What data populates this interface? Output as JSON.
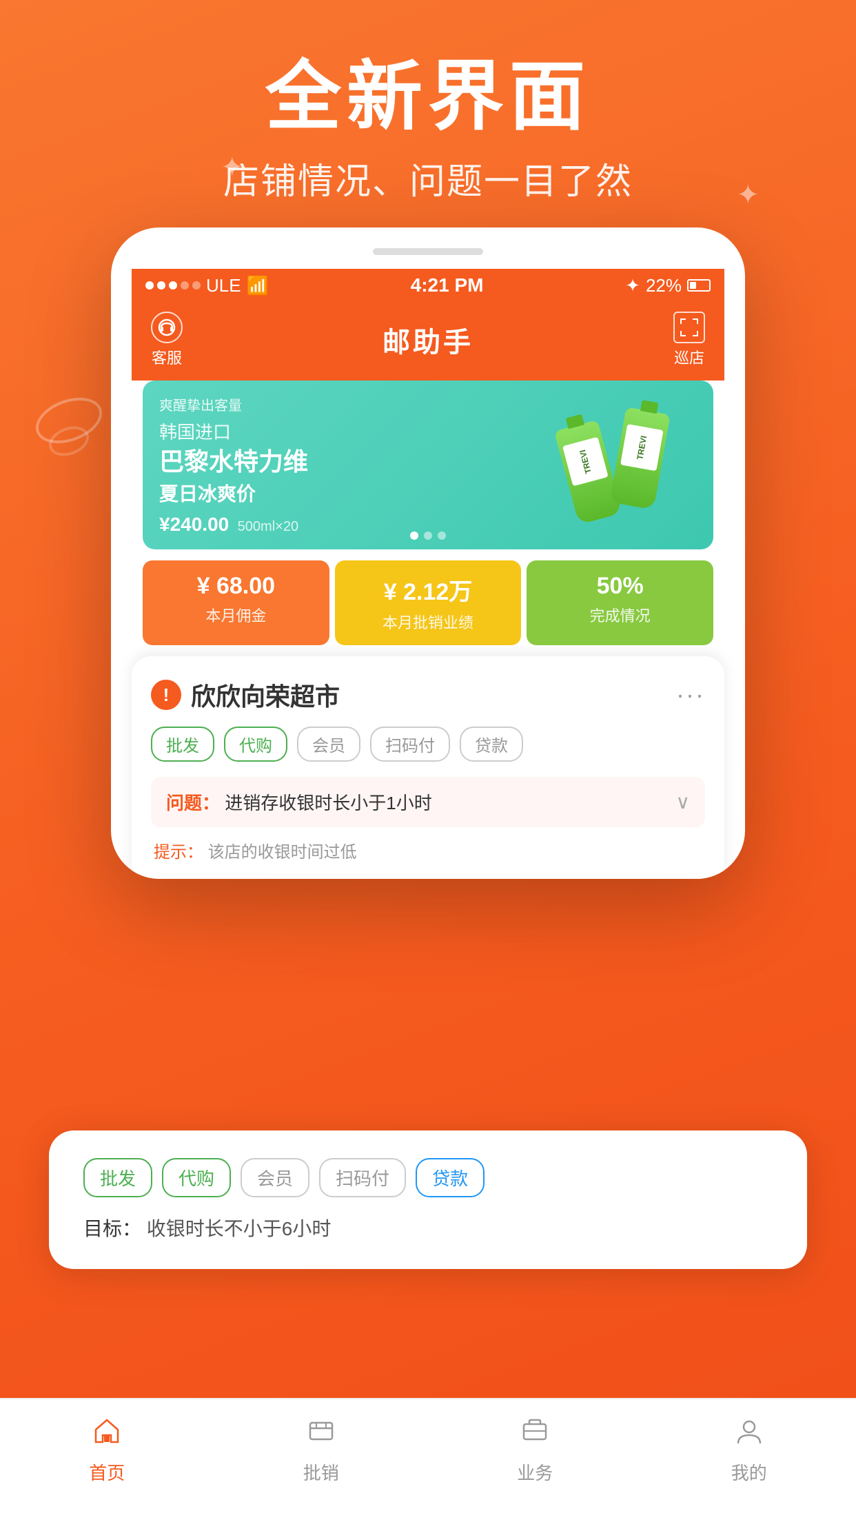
{
  "hero": {
    "title": "全新界面",
    "subtitle": "店铺情况、问题一目了然"
  },
  "phone": {
    "status_bar": {
      "carrier": "ULE",
      "wifi": "wifi",
      "time": "4:21 PM",
      "bluetooth": "bluetooth",
      "battery": "22%"
    },
    "header": {
      "left_label": "客服",
      "title": "邮助手",
      "right_label": "巡店"
    },
    "banner": {
      "tag": "爽醒挚出客量",
      "line1": "韩国进口",
      "title": "巴黎水特力维",
      "subtitle": "夏日冰爽价",
      "price": "¥240.00",
      "unit": "500ml×20"
    },
    "stats": [
      {
        "value": "¥ 68.00",
        "label": "本月佣金",
        "color": "orange"
      },
      {
        "value": "¥ 2.12万",
        "label": "本月批销业绩",
        "color": "yellow"
      },
      {
        "value": "50%",
        "label": "完成情况",
        "color": "green"
      }
    ]
  },
  "store_card": {
    "store_name": "欣欣向荣超市",
    "tags": [
      {
        "label": "批发",
        "type": "green"
      },
      {
        "label": "代购",
        "type": "green"
      },
      {
        "label": "会员",
        "type": "gray"
      },
      {
        "label": "扫码付",
        "type": "gray"
      },
      {
        "label": "贷款",
        "type": "gray"
      }
    ],
    "issue_label": "问题：",
    "issue_text": "进销存收银时长小于1小时",
    "hint_label": "提示：",
    "hint_text": "该店的收银时间过低"
  },
  "floating_card": {
    "tags": [
      {
        "label": "批发",
        "type": "green"
      },
      {
        "label": "代购",
        "type": "green"
      },
      {
        "label": "会员",
        "type": "gray"
      },
      {
        "label": "扫码付",
        "type": "gray"
      },
      {
        "label": "贷款",
        "type": "blue"
      }
    ],
    "goal_label": "目标：",
    "goal_text": "收银时长不小于6小时"
  },
  "bottom_nav": {
    "items": [
      {
        "label": "首页",
        "active": true
      },
      {
        "label": "批销",
        "active": false
      },
      {
        "label": "业务",
        "active": false
      },
      {
        "label": "我的",
        "active": false
      }
    ]
  }
}
